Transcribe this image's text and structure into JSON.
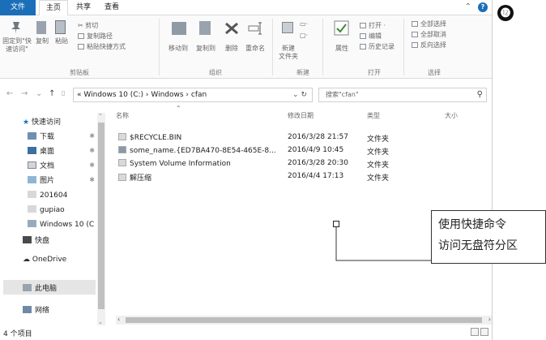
{
  "tabs": {
    "file": "文件",
    "home": "主页",
    "share": "共享",
    "view": "查看"
  },
  "ribbon": {
    "pin_label": "固定到\"快速访问\"",
    "copy": "复制",
    "paste": "粘贴",
    "cut": "剪切",
    "copy_path": "复制路径",
    "paste_shortcut": "粘贴快捷方式",
    "move_to": "移动到",
    "copy_to": "复制到",
    "delete": "删除",
    "rename": "重命名",
    "new_folder": "新建\n文件夹",
    "properties": "属性",
    "open": "打开",
    "edit": "编辑",
    "history": "历史记录",
    "select_all": "全部选择",
    "select_none": "全部取消",
    "invert": "反向选择",
    "groups": {
      "clipboard": "剪贴板",
      "organize": "组织",
      "new": "新建",
      "open": "打开",
      "select": "选择"
    }
  },
  "address": {
    "path": "« Windows 10 (C:) › Windows › cfan",
    "search_placeholder": "搜索\"cfan\""
  },
  "columns": {
    "name": "名称",
    "date": "修改日期",
    "type": "类型",
    "size": "大小"
  },
  "files": [
    {
      "name": "$RECYCLE.BIN",
      "date": "2016/3/28 21:57",
      "type": "文件夹"
    },
    {
      "name": "some_name.{ED7BA470-8E54-465E-8...",
      "date": "2016/4/9 10:45",
      "type": "文件夹"
    },
    {
      "name": "System Volume Information",
      "date": "2016/3/28 20:30",
      "type": "文件夹"
    },
    {
      "name": "解压缩",
      "date": "2016/4/4 17:13",
      "type": "文件夹"
    }
  ],
  "nav": {
    "quick_access": "快速访问",
    "items": [
      "下载",
      "桌面",
      "文档",
      "图片",
      "201604",
      "gupiao",
      "Windows 10 (C",
      "快盘"
    ],
    "onedrive": "OneDrive",
    "this_pc": "此电脑",
    "network": "网络"
  },
  "status": {
    "count": "4 个项目"
  },
  "annotation": {
    "badge": "⓬",
    "line1": "使用快捷命令",
    "line2": "访问无盘符分区"
  },
  "colors": {
    "accent": "#1a6fb8"
  }
}
